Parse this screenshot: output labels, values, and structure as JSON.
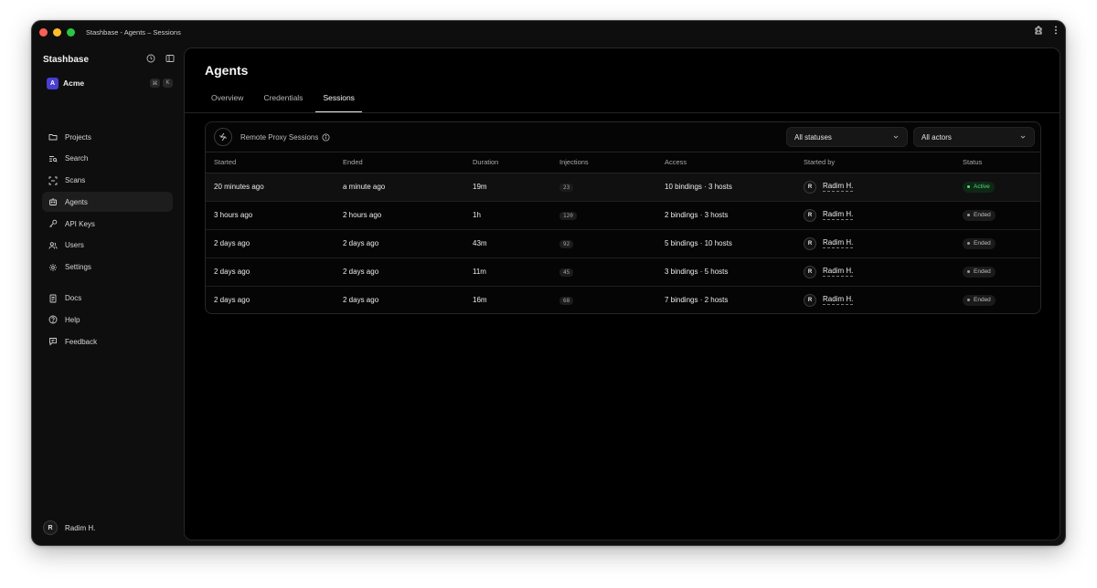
{
  "window": {
    "title": "Stashbase - Agents – Sessions"
  },
  "sidebar": {
    "brand": "Stashbase",
    "org": {
      "initial": "A",
      "name": "Acme",
      "shortcut": [
        "⌘",
        "K"
      ]
    },
    "items": [
      {
        "label": "Projects",
        "icon": "folder-icon"
      },
      {
        "label": "Search",
        "icon": "search-list-icon"
      },
      {
        "label": "Scans",
        "icon": "scan-icon"
      },
      {
        "label": "Agents",
        "icon": "robot-icon",
        "active": true
      },
      {
        "label": "API Keys",
        "icon": "key-icon"
      },
      {
        "label": "Users",
        "icon": "users-icon"
      },
      {
        "label": "Settings",
        "icon": "gear-icon"
      }
    ],
    "secondary": [
      {
        "label": "Docs",
        "icon": "document-icon"
      },
      {
        "label": "Help",
        "icon": "help-icon"
      },
      {
        "label": "Feedback",
        "icon": "feedback-icon"
      }
    ],
    "user": {
      "initial": "R",
      "name": "Radim H."
    }
  },
  "main": {
    "title": "Agents",
    "tabs": [
      {
        "label": "Overview"
      },
      {
        "label": "Credentials"
      },
      {
        "label": "Sessions",
        "active": true
      }
    ],
    "card": {
      "title": "Remote Proxy Sessions",
      "filters": {
        "status": "All statuses",
        "actor": "All actors"
      },
      "columns": [
        "Started",
        "Ended",
        "Duration",
        "Injections",
        "Access",
        "Started by",
        "Status"
      ],
      "rows": [
        {
          "started": "20 minutes ago",
          "ended": "a minute ago",
          "duration": "19m",
          "injections": "23",
          "access": "10 bindings · 3 hosts",
          "by_initial": "R",
          "by": "Radim H.",
          "status": "Active"
        },
        {
          "started": "3 hours ago",
          "ended": "2 hours ago",
          "duration": "1h",
          "injections": "120",
          "access": "2 bindings · 3 hosts",
          "by_initial": "R",
          "by": "Radim H.",
          "status": "Ended"
        },
        {
          "started": "2 days ago",
          "ended": "2 days ago",
          "duration": "43m",
          "injections": "92",
          "access": "5 bindings · 10 hosts",
          "by_initial": "R",
          "by": "Radim H.",
          "status": "Ended"
        },
        {
          "started": "2 days ago",
          "ended": "2 days ago",
          "duration": "11m",
          "injections": "45",
          "access": "3 bindings · 5 hosts",
          "by_initial": "R",
          "by": "Radim H.",
          "status": "Ended"
        },
        {
          "started": "2 days ago",
          "ended": "2 days ago",
          "duration": "16m",
          "injections": "68",
          "access": "7 bindings · 2 hosts",
          "by_initial": "R",
          "by": "Radim H.",
          "status": "Ended"
        }
      ]
    }
  },
  "colors": {
    "accent": "#4a3fd1",
    "active": "#4ade80",
    "background": "#000000"
  }
}
